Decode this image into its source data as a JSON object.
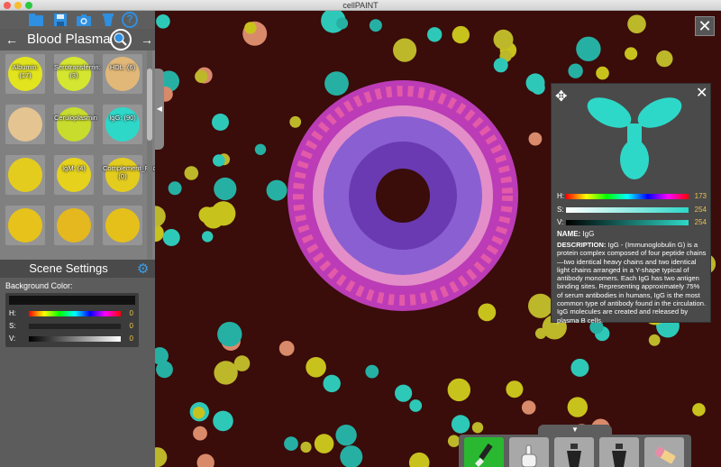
{
  "window": {
    "title": "cellPAINT"
  },
  "toolbar": {
    "icons": [
      "folder-icon",
      "save-icon",
      "camera-icon",
      "bucket-icon",
      "help-icon"
    ],
    "help_label": "?"
  },
  "category": {
    "title": "Blood Plasma",
    "prev": "←",
    "next": "→"
  },
  "molecules": [
    {
      "label": "Albumin: (17)",
      "color": "#e2e41e"
    },
    {
      "label": "Serotransferrin: (3)",
      "color": "#d4e630"
    },
    {
      "label": "HDL: (6)",
      "color": "#e2b878"
    },
    {
      "label": "",
      "color": "#e4c490"
    },
    {
      "label": "Ceruloplasmin",
      "color": "#c8dc2e"
    },
    {
      "label": "IgG: (90)",
      "color": "#2ed8c8"
    },
    {
      "label": "",
      "color": "#e4cc1e"
    },
    {
      "label": "IgM: (4)",
      "color": "#e6d21c"
    },
    {
      "label": "Complement_Factor_C3: (0)",
      "color": "#e4cc1e"
    },
    {
      "label": "",
      "color": "#e6c21a"
    },
    {
      "label": "",
      "color": "#e4b81e"
    },
    {
      "label": "",
      "color": "#e6c01a"
    }
  ],
  "scene": {
    "title": "Scene Settings",
    "background_label": "Background Color:",
    "h_label": "H:",
    "h_value": "0",
    "s_label": "S:",
    "s_value": "0",
    "v_label": "V:",
    "v_value": "0"
  },
  "info": {
    "h_label": "H:",
    "h_value": "173",
    "s_label": "S:",
    "s_value": "254",
    "v_label": "V:",
    "v_value": "254",
    "name_key": "NAME:",
    "name_value": " IgG",
    "desc_key": "DESCRIPTION:",
    "desc_value": " IgG - (Immunoglobulin G) is a protein complex composed of four peptide chains—two identical heavy chains and two identical light chains arranged in a Y-shape typical of antibody monomers. Each IgG has two antigen binding sites. Representing approximately 75% of serum antibodies in humans, IgG is the most common type of antibody found in the circulation. IgG molecules are created and released by plasma B cells.",
    "accent": "#2ed8c8"
  },
  "canvas": {
    "close_label": "✕",
    "collapse_label": "◀",
    "tray_toggle": "▼"
  },
  "tools": [
    "brush-icon",
    "hand-pointer-icon",
    "bucket-tool-icon",
    "bucket-fill-icon",
    "eraser-icon"
  ]
}
